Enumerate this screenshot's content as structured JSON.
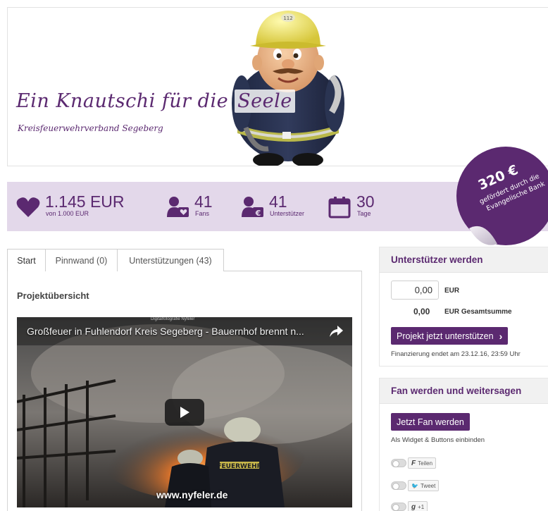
{
  "header": {
    "title_part1": "Ein Knautschi für die ",
    "title_part2": "Seele",
    "subtitle": "Kreisfeuerwehrverband Segeberg",
    "helmet_number": "112"
  },
  "stats": {
    "funding": {
      "value": "1.145 EUR",
      "label": "von 1.000 EUR",
      "icon": "heart-icon"
    },
    "fans": {
      "value": "41",
      "label": "Fans",
      "icon": "fan-user-icon"
    },
    "supporters": {
      "value": "41",
      "label": "Unterstützer",
      "icon": "supporter-euro-icon"
    },
    "days": {
      "value": "30",
      "label": "Tage",
      "icon": "calendar-icon"
    }
  },
  "badge": {
    "amount": "320 €",
    "line1": "gefördert durch die",
    "line2": "Evangelische Bank"
  },
  "tabs": [
    {
      "label": "Start",
      "active": true
    },
    {
      "label": "Pinnwand (0)",
      "active": false
    },
    {
      "label": "Unterstützungen (43)",
      "active": false
    }
  ],
  "main": {
    "section_title": "Projektübersicht",
    "video": {
      "title": "Großfeuer in Fuhlendorf Kreis Segeberg - Bauernhof brennt n...",
      "credit": "Digitalfotografie Nyfeler",
      "watermark": "www.nyfeler.de",
      "helmet_text": "FEUERWEHR"
    }
  },
  "support_box": {
    "heading": "Unterstützer werden",
    "amount_value": "0,00",
    "currency": "EUR",
    "total_value": "0,00",
    "total_label": "EUR Gesamtsumme",
    "button_label": "Projekt jetzt unterstützen",
    "button_arrow": "›",
    "deadline": "Finanzierung endet am 23.12.16, 23:59 Uhr"
  },
  "fan_box": {
    "heading": "Fan werden und weitersagen",
    "button_label": "Jetzt Fan werden",
    "widget_note": "Als Widget & Buttons einbinden",
    "share": [
      {
        "glyph": "F",
        "label": "Teilen"
      },
      {
        "glyph": "🐦",
        "label": "Tweet"
      },
      {
        "glyph": "g",
        "label": "+1"
      }
    ]
  },
  "colors": {
    "brand": "#5b2970",
    "stats_bg": "#e3d8ea",
    "panel_head_bg": "#f1f1f1"
  }
}
